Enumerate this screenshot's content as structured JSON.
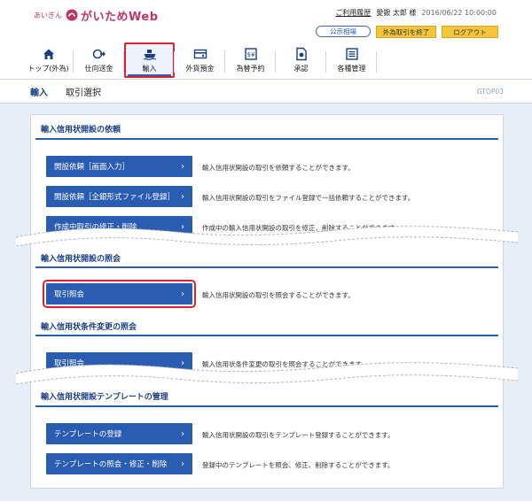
{
  "header": {
    "logo_small": "あいぎん",
    "logo_main": "がいためWeb",
    "link_history": "ご利用履歴",
    "user": "愛銀 太郎 様",
    "datetime": "2016/06/22 10:00:00",
    "rate_button": "公示相場",
    "end_button": "外為取引を終了",
    "logout_button": "ログアウト"
  },
  "nav": {
    "items": [
      {
        "label": "トップ(外為)",
        "icon": "home-icon"
      },
      {
        "label": "仕向送金",
        "icon": "remittance-icon"
      },
      {
        "label": "輸入",
        "icon": "import-ship-icon"
      },
      {
        "label": "外貨預金",
        "icon": "deposit-icon"
      },
      {
        "label": "為替予約",
        "icon": "forward-contract-icon"
      },
      {
        "label": "承認",
        "icon": "approval-icon"
      },
      {
        "label": "各種管理",
        "icon": "management-icon"
      }
    ]
  },
  "titlebar": {
    "category": "輸入",
    "title": "取引選択",
    "screen_code": "GTOP03"
  },
  "sections": [
    {
      "heading": "輸入信用状開設の依頼",
      "actions": [
        {
          "label": "開設依頼［画面入力］",
          "desc": "輸入信用状開設の取引を依頼することができます。"
        },
        {
          "label": "開設依頼［全銀形式ファイル登録］",
          "desc": "輸入信用状開設の取引をファイル登録で一括依頼することができます。"
        },
        {
          "label": "作成中取引の修正・削除",
          "desc": "作成中の輸入信用状開設の取引を修正、削除することができます。"
        }
      ]
    },
    {
      "heading": "輸入信用状開設の照会",
      "actions": [
        {
          "label": "取引照会",
          "desc": "輸入信用状開設の取引を照会することができます。"
        }
      ]
    },
    {
      "heading": "輸入信用状条件変更の照会",
      "actions": [
        {
          "label": "取引照会",
          "desc": "輸入信用状条件変更の取引を照会することができます。"
        }
      ]
    },
    {
      "heading": "輸入信用状開設テンプレートの管理",
      "actions": [
        {
          "label": "テンプレートの登録",
          "desc": "輸入信用状開設の取引をテンプレート登録することができます。"
        },
        {
          "label": "テンプレートの照会・修正・削除",
          "desc": "登録中のテンプレートを照会、修正、削除することができます。"
        }
      ]
    }
  ],
  "colors": {
    "brand_pink": "#c0346a",
    "primary_blue": "#2a5cb2",
    "highlight_red": "#e0202a",
    "button_yellow": "#f4c53a"
  }
}
